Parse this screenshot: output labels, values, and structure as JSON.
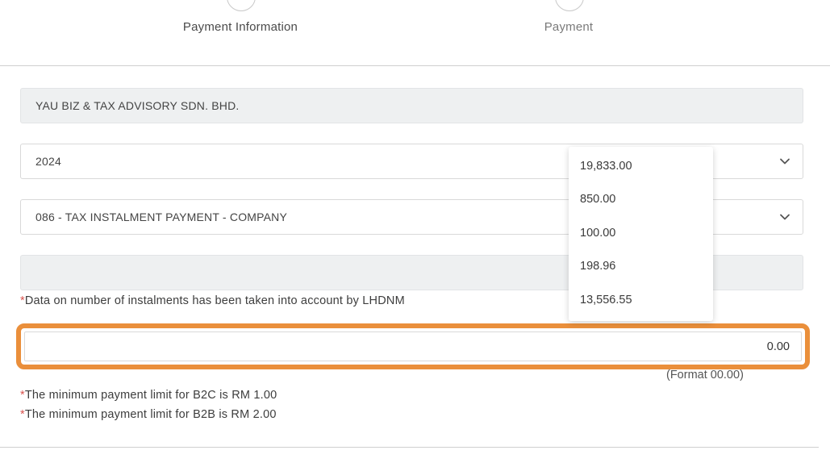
{
  "steps": [
    {
      "label": "Payment Information"
    },
    {
      "label": "Payment"
    }
  ],
  "form": {
    "company_name": "YAU BIZ & TAX ADVISORY SDN. BHD.",
    "year": "2024",
    "payment_code": "086 - TAX INSTALMENT PAYMENT - COMPANY",
    "instalment_field": "",
    "instalment_note": "Data on number of instalments has been taken into account by LHDNM",
    "amount_value": "0.00",
    "amount_format_hint": "(Format 00.00)",
    "min_limit_b2c": "The minimum payment limit for B2C is RM 1.00",
    "min_limit_b2b": "The minimum payment limit for B2B is RM 2.00",
    "required_marker": "*"
  },
  "dropdown": {
    "options": [
      "19,833.00",
      "850.00",
      "100.00",
      "198.96",
      "13,556.55"
    ]
  },
  "colors": {
    "highlight": "#ea8f3b",
    "required": "#d9534f",
    "readonly_bg": "#eef0f1"
  }
}
